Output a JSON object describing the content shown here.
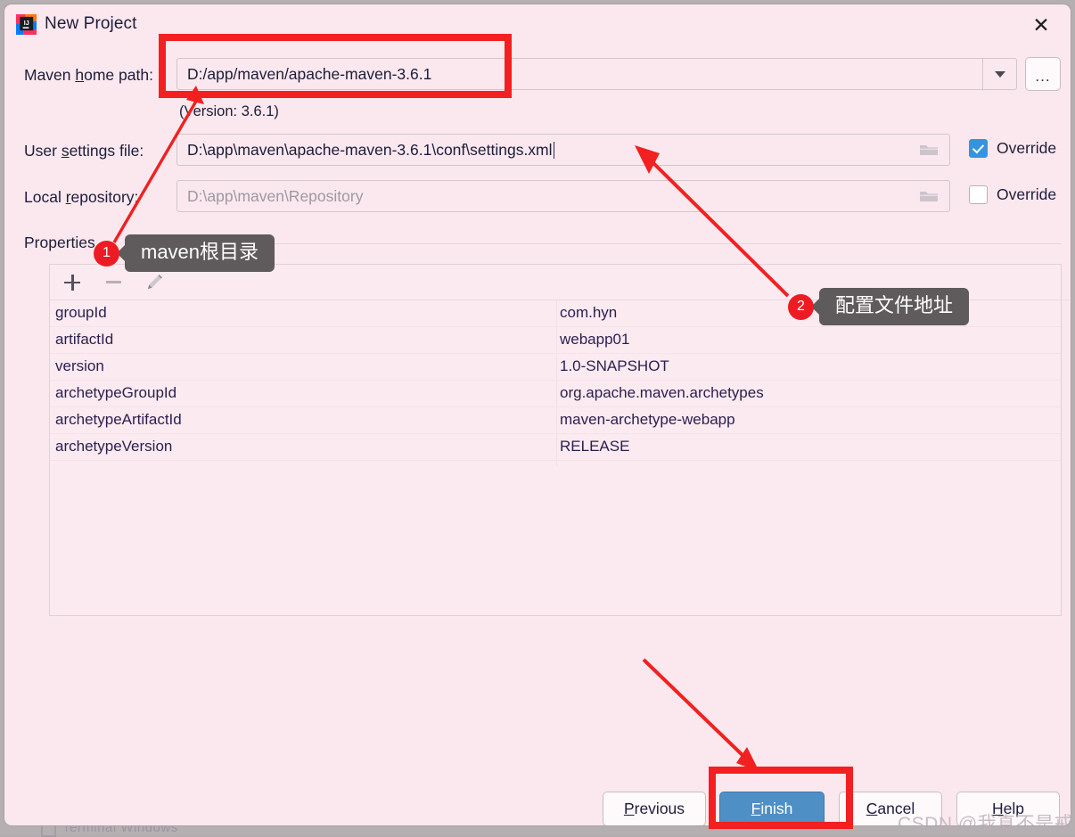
{
  "window": {
    "title": "New Project",
    "logo_icon": "intellij-idea-logo",
    "close_icon": "close-icon"
  },
  "form": {
    "maven_home": {
      "label_pre": "Maven ",
      "label_mnemonic": "h",
      "label_post": "ome path:",
      "value": "D:/app/maven/apache-maven-3.6.1",
      "dropdown_icon": "chevron-down-icon",
      "browse_label": "...",
      "version_note": "(Version: 3.6.1)"
    },
    "user_settings": {
      "label_pre": "User ",
      "label_mnemonic": "s",
      "label_post": "ettings file:",
      "value": "D:\\app\\maven\\apache-maven-3.6.1\\conf\\settings.xml",
      "folder_icon": "folder-icon",
      "override_label": "Override",
      "override_checked": true
    },
    "local_repository": {
      "label_pre": "Local ",
      "label_mnemonic": "r",
      "label_post": "epository:",
      "value": "D:\\app\\maven\\Repository",
      "folder_icon": "folder-icon",
      "override_label": "Override",
      "override_checked": false
    }
  },
  "properties": {
    "section_label": "Properties",
    "toolbar": {
      "add_icon": "plus-icon",
      "remove_icon": "minus-icon",
      "edit_icon": "pencil-icon"
    },
    "rows": [
      {
        "name": "groupId",
        "value": "com.hyn"
      },
      {
        "name": "artifactId",
        "value": "webapp01"
      },
      {
        "name": "version",
        "value": "1.0-SNAPSHOT"
      },
      {
        "name": "archetypeGroupId",
        "value": "org.apache.maven.archetypes"
      },
      {
        "name": "archetypeArtifactId",
        "value": "maven-archetype-webapp"
      },
      {
        "name": "archetypeVersion",
        "value": "RELEASE"
      }
    ]
  },
  "buttons": {
    "previous": {
      "pre": "",
      "mnemonic": "P",
      "post": "revious"
    },
    "finish": {
      "pre": "",
      "mnemonic": "F",
      "post": "inish"
    },
    "cancel": {
      "pre": "",
      "mnemonic": "C",
      "post": "ancel"
    },
    "help": {
      "pre": "",
      "mnemonic": "H",
      "post": "elp"
    }
  },
  "annotations": {
    "callout_1": {
      "number": "1",
      "text": "maven根目录"
    },
    "callout_2": {
      "number": "2",
      "text": "配置文件地址"
    },
    "highlight_color": "#f22020"
  },
  "watermark": "CSDN @我真不是戒哥",
  "background": {
    "strip_text": "Terminal        Windows"
  },
  "colors": {
    "dialog_bg": "#fae8ee",
    "desktop_bg": "#b5afb2",
    "accent_blue": "#4e8fc6",
    "checkbox_blue": "#3694de",
    "annotation_red": "#ed1c24",
    "text": "#1d1d3a"
  }
}
